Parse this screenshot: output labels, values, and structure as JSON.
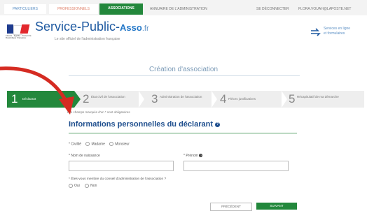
{
  "topnav": {
    "tabs": [
      {
        "label": "Particuliers"
      },
      {
        "label": "Professionnels"
      },
      {
        "label": "Associations"
      }
    ],
    "annuaire": "Annuaire de l'administration",
    "deconnexion": "Se déconnecter",
    "user": "flora.vouah@laposte.net"
  },
  "header": {
    "brand_main": "Service-Public-",
    "brand_asso": "Asso",
    "brand_fr": ".fr",
    "subtitle": "Le site officiel de l'administration française",
    "flag_caption": "Liberté · Égalité · Fraternité · République Française",
    "services_line1": "Services en ligne",
    "services_line2": "et formulaires"
  },
  "page_title": "Création d'association",
  "steps": [
    {
      "num": "1",
      "label": "Déclarant",
      "active": true
    },
    {
      "num": "2",
      "label": "État civil de l'association"
    },
    {
      "num": "3",
      "label": "Administration de l'association"
    },
    {
      "num": "4",
      "label": "Pièces justificatives"
    },
    {
      "num": "5",
      "label": "Récapitulatif de ma démarche"
    }
  ],
  "required_note": "Les champs marqués d'un * sont obligatoires",
  "section_title": "Informations personnelles du déclarant",
  "form": {
    "civilite_label": "* Civilité",
    "madame": "Madame",
    "monsieur": "Monsieur",
    "nom_label": "* Nom de naissance",
    "prenom_label": "* Prénom",
    "conseil_question": "* Êtes-vous membre du conseil d'administration de l'association ?",
    "oui": "Oui",
    "non": "Non"
  },
  "buttons": {
    "previous": "Précédent",
    "next": "Suivant"
  },
  "colors": {
    "accent_green": "#23883c",
    "brand_blue": "#1f5aa1",
    "annotation_red": "#d52b22"
  }
}
